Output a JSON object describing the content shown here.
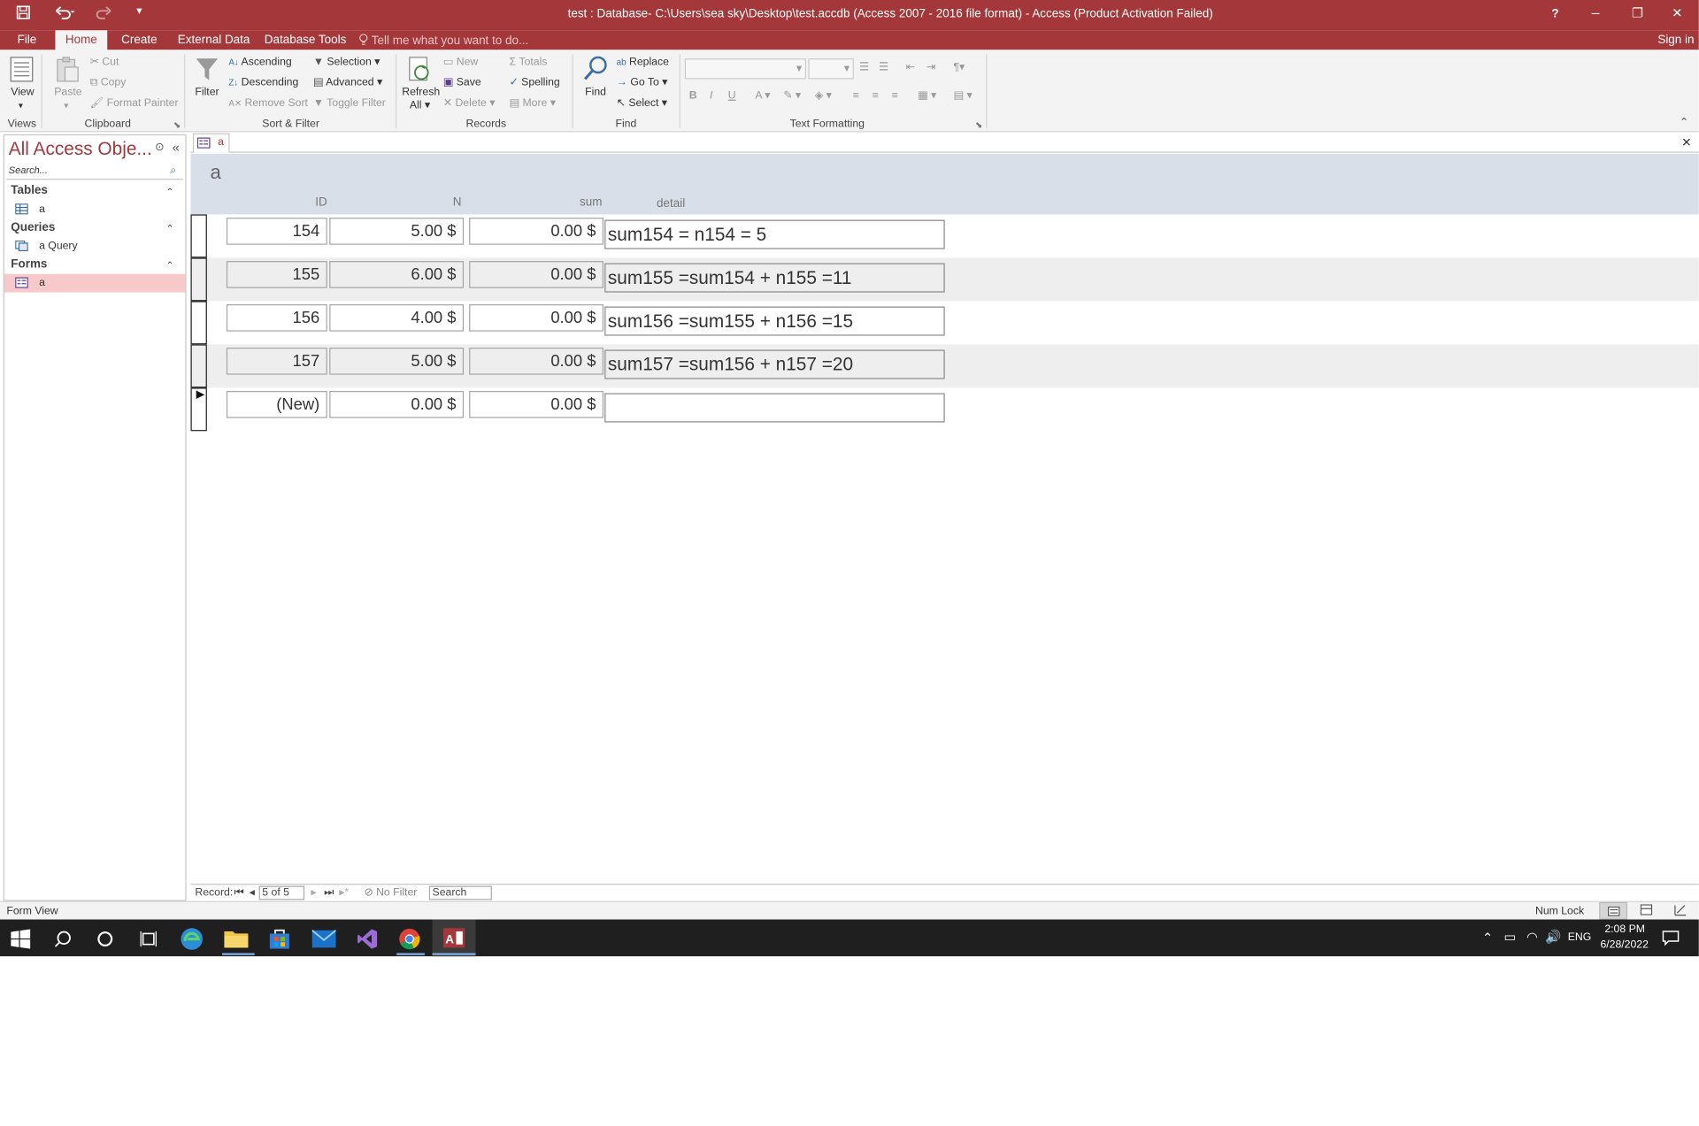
{
  "window": {
    "title": "test : Database- C:\\Users\\sea sky\\Desktop\\test.accdb (Access 2007 - 2016 file format) - Access (Product Activation Failed)",
    "help": "?",
    "minimize": "–",
    "restore": "❐",
    "close": "✕"
  },
  "ribbon_tabs": {
    "file": "File",
    "home": "Home",
    "create": "Create",
    "external": "External Data",
    "dbtools": "Database Tools",
    "tellme": "Tell me what you want to do...",
    "signin": "Sign in"
  },
  "ribbon": {
    "view": "View",
    "views_group": "Views",
    "paste": "Paste",
    "cut": "Cut",
    "copy": "Copy",
    "format_painter": "Format Painter",
    "clipboard_group": "Clipboard",
    "filter": "Filter",
    "ascending": "Ascending",
    "descending": "Descending",
    "remove_sort": "Remove Sort",
    "selection": "Selection",
    "advanced": "Advanced",
    "toggle_filter": "Toggle Filter",
    "sortfilter_group": "Sort & Filter",
    "refresh": "Refresh",
    "refresh_all": "All",
    "new": "New",
    "save": "Save",
    "delete": "Delete",
    "totals": "Totals",
    "spelling": "Spelling",
    "more": "More",
    "records_group": "Records",
    "find": "Find",
    "replace": "Replace",
    "goto": "Go To",
    "select": "Select",
    "find_group": "Find",
    "bold": "B",
    "italic": "I",
    "underline": "U",
    "textformat_group": "Text Formatting"
  },
  "nav": {
    "header": "All Access Obje...",
    "search_placeholder": "Search...",
    "groups": [
      {
        "name": "Tables",
        "items": [
          "a"
        ]
      },
      {
        "name": "Queries",
        "items": [
          "a Query"
        ]
      },
      {
        "name": "Forms",
        "items": [
          "a"
        ]
      }
    ]
  },
  "document": {
    "tab_label": "a",
    "form_title": "a",
    "columns": {
      "id": "ID",
      "n": "N",
      "sum": "sum",
      "detail": "detail"
    },
    "records": [
      {
        "id": "154",
        "n": "5.00 $",
        "sum": "0.00 $",
        "detail": "sum154 = n154 = 5"
      },
      {
        "id": "155",
        "n": "6.00 $",
        "sum": "0.00 $",
        "detail": "sum155 =sum154 + n155 =11"
      },
      {
        "id": "156",
        "n": "4.00 $",
        "sum": "0.00 $",
        "detail": "sum156 =sum155 + n156 =15"
      },
      {
        "id": "157",
        "n": "5.00 $",
        "sum": "0.00 $",
        "detail": "sum157 =sum156 + n157 =20"
      },
      {
        "id": "(New)",
        "n": "0.00 $",
        "sum": "0.00 $",
        "detail": ""
      }
    ]
  },
  "record_nav": {
    "label": "Record:",
    "position": "5 of 5",
    "filter": "No Filter",
    "search": "Search"
  },
  "status": {
    "left": "Form View",
    "numlock": "Num Lock"
  },
  "taskbar": {
    "lang": "ENG",
    "time": "2:08 PM",
    "date": "6/28/2022"
  }
}
